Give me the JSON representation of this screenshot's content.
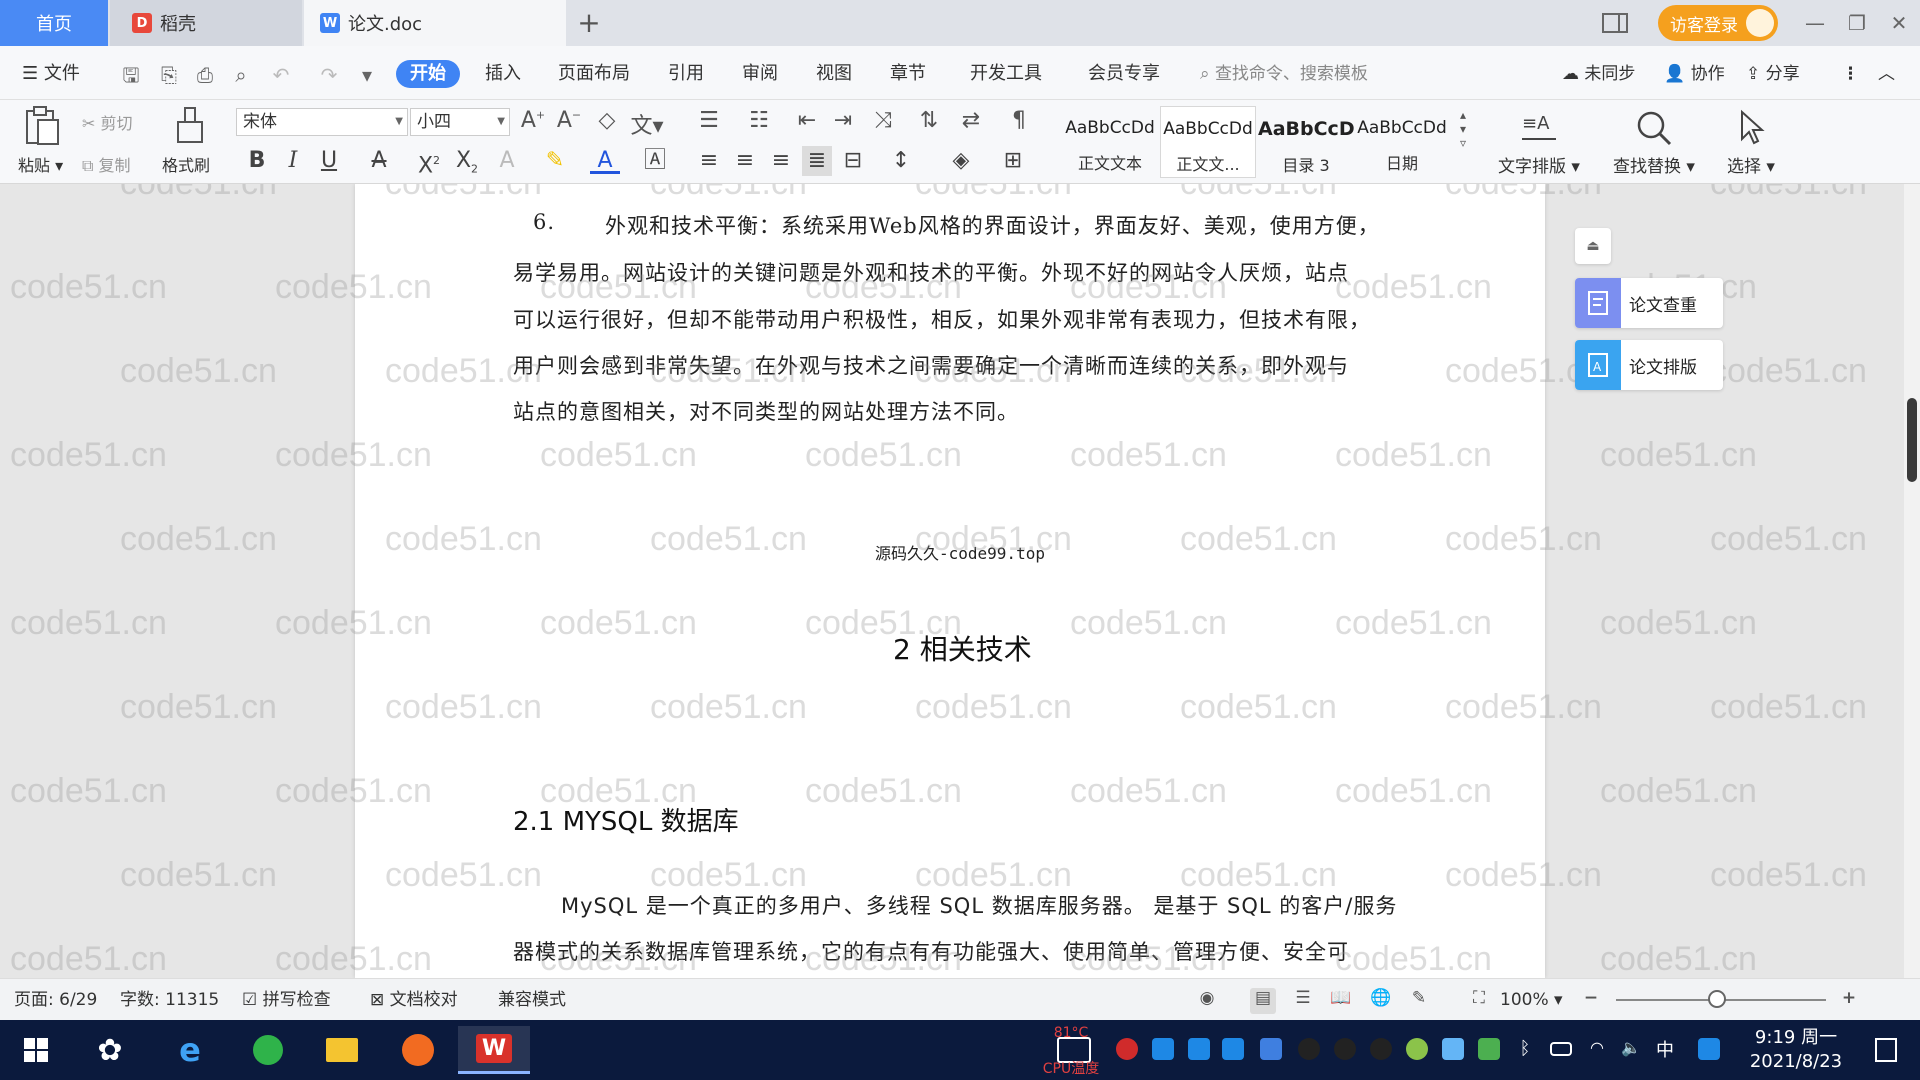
{
  "titlebar": {
    "tabs": [
      {
        "label": "首页"
      },
      {
        "label": "稻壳"
      },
      {
        "label": "论文.doc"
      }
    ],
    "login_label": "访客登录"
  },
  "menubar": {
    "file_label": "文件",
    "items": [
      "开始",
      "插入",
      "页面布局",
      "引用",
      "审阅",
      "视图",
      "章节",
      "开发工具",
      "会员专享"
    ],
    "search_placeholder": "查找命令、搜索模板",
    "sync_label": "未同步",
    "collab_label": "协作",
    "share_label": "分享"
  },
  "ribbon": {
    "paste_label": "粘贴",
    "cut_label": "剪切",
    "copy_label": "复制",
    "format_painter_label": "格式刷",
    "font_name": "宋体",
    "font_size": "小四",
    "styles": [
      {
        "sample": "AaBbCcDd",
        "name": "正文文本"
      },
      {
        "sample": "AaBbCcDd",
        "name": "正文文..."
      },
      {
        "sample": "AaBbCcD",
        "name": "目录 3"
      },
      {
        "sample": "AaBbCcDd",
        "name": "日期"
      }
    ],
    "text_layout_label": "文字排版",
    "find_replace_label": "查找替换",
    "select_label": "选择"
  },
  "document": {
    "list_number": "6.",
    "para_lines": [
      "外观和技术平衡：系统采用Web风格的界面设计，界面友好、美观，使用方便，",
      "易学易用。网站设计的关键问题是外观和技术的平衡。外现不好的网站令人厌烦，站点",
      "可以运行很好，但却不能带动用户积极性，相反，如果外观非常有表现力，但技术有限，",
      "用户则会感到非常失望。在外观与技术之间需要确定一个清晰而连续的关系，即外观与",
      "站点的意图相关，对不同类型的网站处理方法不同。"
    ],
    "footer_text": "源码久久-code99.top",
    "heading1": "2 相关技术",
    "heading2": "2.1 MYSQL 数据库",
    "para2_lines": [
      "MySQL 是一个真正的多用户、多线程 SQL 数据库服务器。 是基于 SQL 的客户/服务",
      "器模式的关系数据库管理系统，它的有点有有功能强大、使用简单、管理方便、安全可"
    ],
    "watermark_text": "code51.cn"
  },
  "side_panel": {
    "check_label": "论文查重",
    "layout_label": "论文排版"
  },
  "statusbar": {
    "page": "页面: 6/29",
    "word_count": "字数: 11315",
    "spell_check": "拼写检查",
    "doc_proof": "文档校对",
    "compat_mode": "兼容模式",
    "zoom": "100%"
  },
  "taskbar": {
    "cpu_line1": "81°C",
    "cpu_line2": "CPU温度",
    "ime": "中",
    "time": "9:19 周一",
    "date": "2021/8/23"
  }
}
